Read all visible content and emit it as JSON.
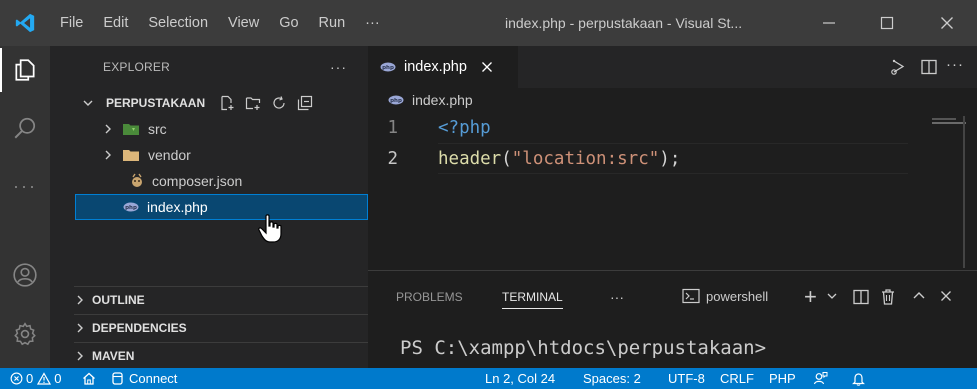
{
  "titlebar": {
    "menu": [
      "File",
      "Edit",
      "Selection",
      "View",
      "Go",
      "Run",
      "···"
    ],
    "title": "index.php - perpustakaan - Visual St...",
    "controls": [
      "minimize-icon",
      "restore-icon",
      "close-icon"
    ]
  },
  "activity_bar": {
    "icons": [
      "explorer-icon",
      "search-icon",
      "more-icon",
      "account-icon",
      "settings-gear-icon"
    ]
  },
  "sidebar": {
    "header": "EXPLORER",
    "more": "···",
    "folder": "PERPUSTAKAAN",
    "items": [
      {
        "label": "src",
        "type": "folder"
      },
      {
        "label": "vendor",
        "type": "folder"
      },
      {
        "label": "composer.json",
        "type": "file"
      },
      {
        "label": "index.php",
        "type": "file",
        "selected": true
      }
    ],
    "sections": [
      "OUTLINE",
      "DEPENDENCIES",
      "MAVEN"
    ]
  },
  "editor": {
    "tab_label": "index.php",
    "breadcrumb": "index.php",
    "lines": [
      {
        "num": "1",
        "tokens": [
          {
            "t": "<?php",
            "c": "#569cd6"
          }
        ]
      },
      {
        "num": "2",
        "tokens": [
          {
            "t": "header",
            "c": "#dcdcaa"
          },
          {
            "t": "(",
            "c": "#d4d4d4"
          },
          {
            "t": "\"location:src\"",
            "c": "#ce9178"
          },
          {
            "t": ");",
            "c": "#d4d4d4"
          }
        ]
      }
    ]
  },
  "panel": {
    "tabs": [
      "PROBLEMS",
      "TERMINAL",
      "···"
    ],
    "active_tab": "TERMINAL",
    "terminal_name": "powershell",
    "prompt": "PS C:\\xampp\\htdocs\\perpustakaan>"
  },
  "statusbar": {
    "errors": "0",
    "warnings": "0",
    "connect": "Connect",
    "position": "Ln 2, Col 24",
    "spaces": "Spaces: 2",
    "encoding": "UTF-8",
    "eol": "CRLF",
    "language": "PHP"
  },
  "colors": {
    "accent": "#007acc",
    "selection": "#094771",
    "keyword": "#569cd6",
    "function": "#dcdcaa",
    "string": "#ce9178"
  }
}
